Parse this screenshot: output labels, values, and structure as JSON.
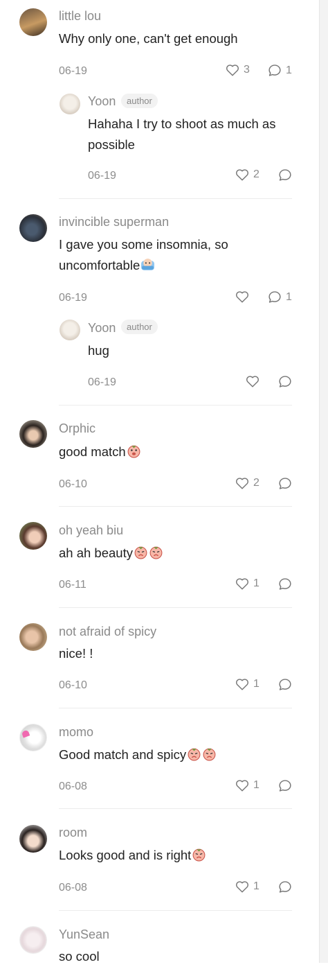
{
  "author_label": "author",
  "comments": [
    {
      "user": "little lou",
      "text": "Why only one, can't get enough",
      "date": "06-19",
      "likes": "3",
      "replies": "1",
      "reply": {
        "user": "Yoon",
        "text": "Hahaha I try to shoot as much as possible",
        "date": "06-19",
        "likes": "2"
      }
    },
    {
      "user": "invincible superman",
      "text": "I gave you some insomnia, so uncomfortable",
      "date": "06-19",
      "likes": "",
      "replies": "1",
      "reply": {
        "user": "Yoon",
        "text": "hug",
        "date": "06-19",
        "likes": ""
      }
    },
    {
      "user": "Orphic",
      "text": "good match",
      "date": "06-10",
      "likes": "2",
      "replies": ""
    },
    {
      "user": "oh yeah biu",
      "text": "ah ah beauty",
      "date": "06-11",
      "likes": "1",
      "replies": ""
    },
    {
      "user": "not afraid of spicy",
      "text": "nice! !",
      "date": "06-10",
      "likes": "1",
      "replies": ""
    },
    {
      "user": "momo",
      "text": "Good match and spicy",
      "date": "06-08",
      "likes": "1",
      "replies": ""
    },
    {
      "user": "room",
      "text": "Looks good and is right",
      "date": "06-08",
      "likes": "1",
      "replies": ""
    },
    {
      "user": "YunSean",
      "text": "so cool"
    }
  ]
}
